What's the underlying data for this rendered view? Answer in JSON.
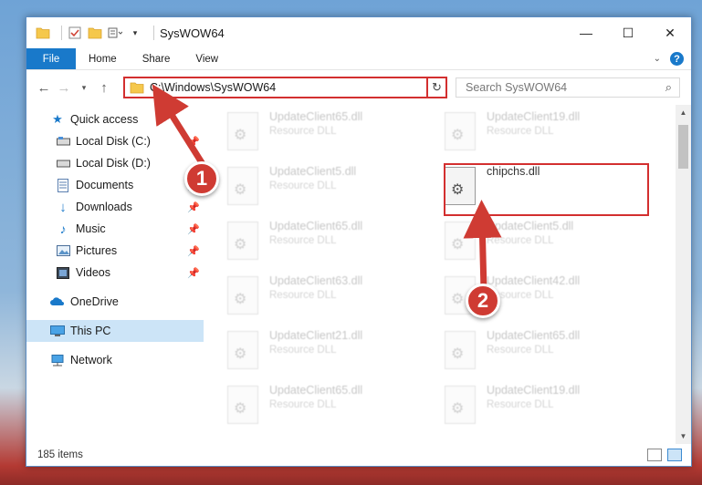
{
  "window": {
    "title": "SysWOW64",
    "controls": [
      "—",
      "☐",
      "✕"
    ]
  },
  "ribbon": {
    "tabs": [
      "File",
      "Home",
      "Share",
      "View"
    ],
    "help": "?"
  },
  "address": {
    "path": "C:\\Windows\\SysWOW64",
    "search_placeholder": "Search SysWOW64"
  },
  "sidebar": {
    "items": [
      {
        "label": "Quick access",
        "icon": "star-icon"
      },
      {
        "label": "Local Disk (C:)",
        "icon": "drive-icon",
        "pinned": true
      },
      {
        "label": "Local Disk (D:)",
        "icon": "drive-icon"
      },
      {
        "label": "Documents",
        "icon": "documents-icon",
        "pinned": true
      },
      {
        "label": "Downloads",
        "icon": "download-icon",
        "pinned": true
      },
      {
        "label": "Music",
        "icon": "music-icon",
        "pinned": true
      },
      {
        "label": "Pictures",
        "icon": "pictures-icon",
        "pinned": true
      },
      {
        "label": "Videos",
        "icon": "videos-icon",
        "pinned": true
      },
      {
        "label": "OneDrive",
        "icon": "cloud-icon"
      },
      {
        "label": "This PC",
        "icon": "computer-icon"
      },
      {
        "label": "Network",
        "icon": "network-icon"
      }
    ]
  },
  "files": [
    {
      "name": "UpdateClient65.dll",
      "type": "Resource DLL"
    },
    {
      "name": "UpdateClient19.dll",
      "type": "Resource DLL"
    },
    {
      "name": "UpdateClient5.dll",
      "type": "Resource DLL"
    },
    {
      "name": "chipchs.dll",
      "type": ""
    },
    {
      "name": "UpdateClient65.dll",
      "type": "Resource DLL"
    },
    {
      "name": "UpdateClient5.dll",
      "type": "Resource DLL"
    },
    {
      "name": "UpdateClient63.dll",
      "type": "Resource DLL"
    },
    {
      "name": "UpdateClient42.dll",
      "type": "Resource DLL"
    },
    {
      "name": "UpdateClient21.dll",
      "type": "Resource DLL"
    },
    {
      "name": "UpdateClient65.dll",
      "type": "Resource DLL"
    },
    {
      "name": "UpdateClient65.dll",
      "type": "Resource DLL"
    },
    {
      "name": "UpdateClient19.dll",
      "type": "Resource DLL"
    }
  ],
  "status": {
    "item_count": "185 items"
  },
  "annotations": {
    "step1": "1",
    "step2": "2",
    "highlight_color": "#d32f2f",
    "callout_color": "#cf3b33"
  },
  "colors": {
    "accent": "#1979ca",
    "selected": "#cce4f7"
  }
}
